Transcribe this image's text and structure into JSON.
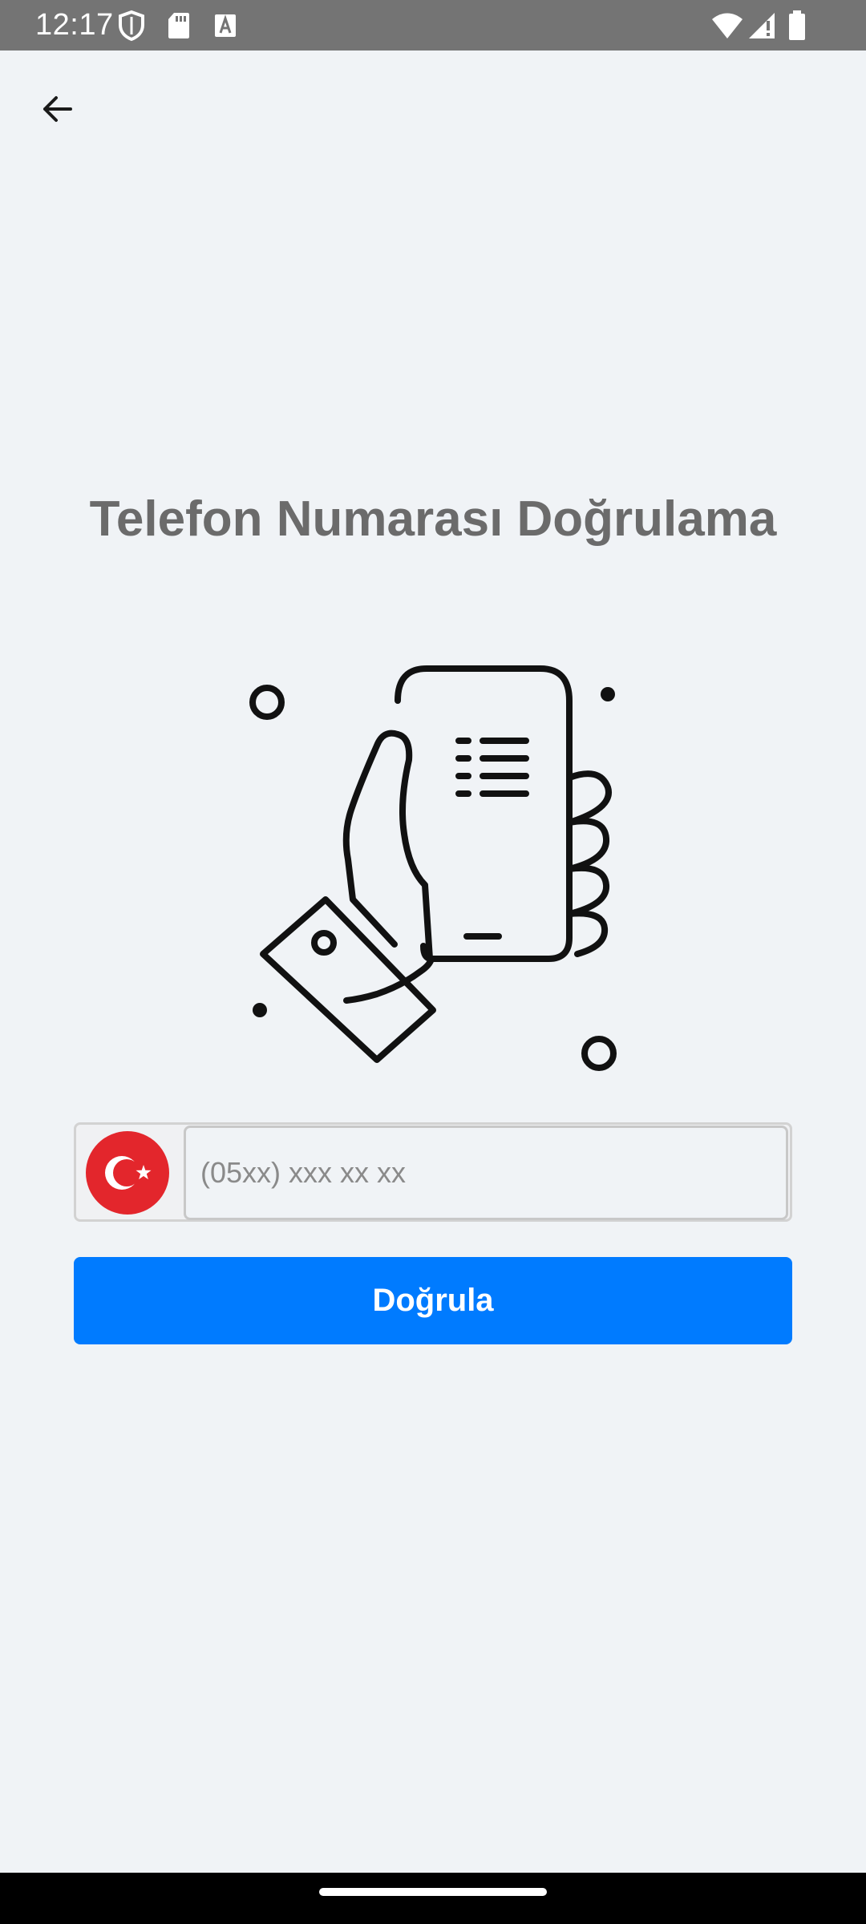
{
  "status_bar": {
    "time": "12:17",
    "icons": [
      "shield-icon",
      "sd-card-icon",
      "text-badge-icon",
      "wifi-icon",
      "signal-icon",
      "battery-icon"
    ]
  },
  "app_bar": {
    "back_icon": "arrow-left-icon"
  },
  "main": {
    "title": "Telefon Numarası Doğrulama",
    "illustration": "hand-holding-phone-icon",
    "phone_input": {
      "placeholder": "(05xx) xxx xx xx",
      "value": ""
    },
    "country_flag": "turkey-flag-icon",
    "verify_label": "Doğrula"
  },
  "colors": {
    "background": "#f0f3f6",
    "primary": "#007bff",
    "flag_red": "#e3262c",
    "title_gray": "#6b6b6b"
  }
}
